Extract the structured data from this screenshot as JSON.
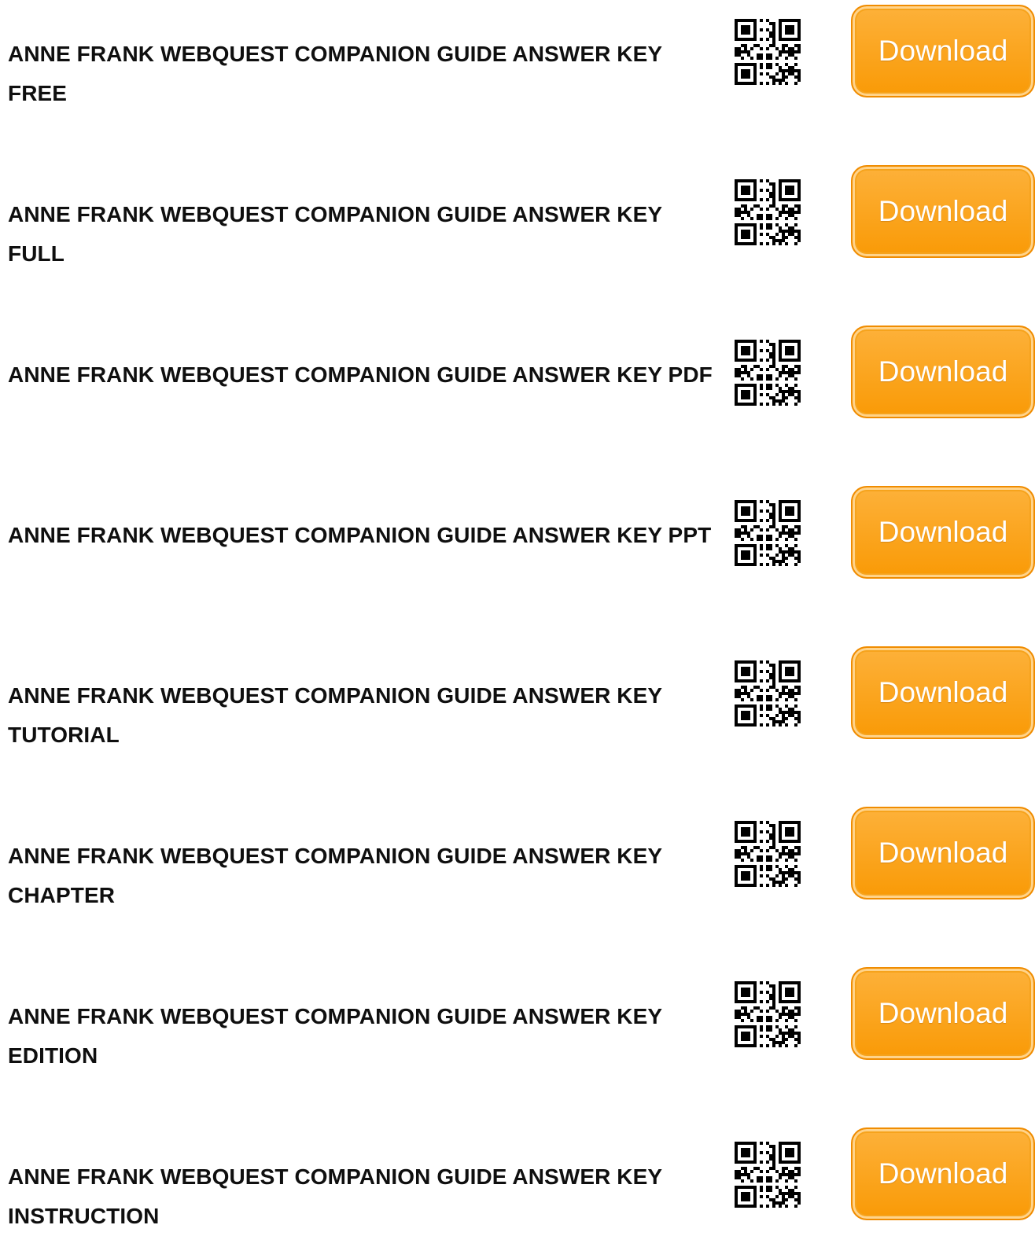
{
  "colors": {
    "title_text": "#0f0f0f",
    "button_fill": "#f99a06",
    "button_border": "#f08c00",
    "button_text": "#ffffff",
    "qr_fill": "#000000"
  },
  "items": [
    {
      "title": "ANNE FRANK WEBQUEST COMPANION GUIDE ANSWER KEY FREE",
      "qr_icon": "qr-code-icon",
      "button_label": "Download"
    },
    {
      "title": "ANNE FRANK WEBQUEST COMPANION GUIDE ANSWER KEY FULL",
      "qr_icon": "qr-code-icon",
      "button_label": "Download"
    },
    {
      "title": "ANNE FRANK WEBQUEST COMPANION GUIDE ANSWER KEY PDF",
      "qr_icon": "qr-code-icon",
      "button_label": "Download"
    },
    {
      "title": "ANNE FRANK WEBQUEST COMPANION GUIDE ANSWER KEY PPT",
      "qr_icon": "qr-code-icon",
      "button_label": "Download"
    },
    {
      "title": "ANNE FRANK WEBQUEST COMPANION GUIDE ANSWER KEY TUTORIAL",
      "qr_icon": "qr-code-icon",
      "button_label": "Download"
    },
    {
      "title": "ANNE FRANK WEBQUEST COMPANION GUIDE ANSWER KEY CHAPTER",
      "qr_icon": "qr-code-icon",
      "button_label": "Download"
    },
    {
      "title": "ANNE FRANK WEBQUEST COMPANION GUIDE ANSWER KEY EDITION",
      "qr_icon": "qr-code-icon",
      "button_label": "Download"
    },
    {
      "title": "ANNE FRANK WEBQUEST COMPANION GUIDE ANSWER KEY INSTRUCTION",
      "qr_icon": "qr-code-icon",
      "button_label": "Download"
    }
  ]
}
